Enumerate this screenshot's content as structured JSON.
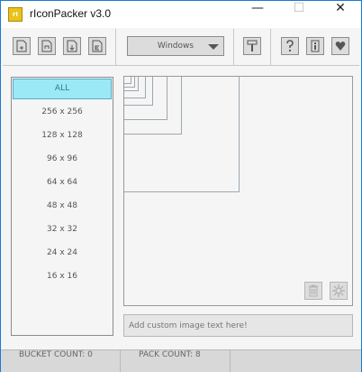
{
  "window": {
    "title": "rIconPacker v3.0",
    "icon_name": "app-logo-icon",
    "controls": {
      "minimize": "—",
      "maximize": "☐",
      "close": "✕"
    }
  },
  "toolbar": {
    "file_buttons": [
      "new-file-icon",
      "open-file-icon",
      "save-file-icon",
      "export-file-icon"
    ],
    "platform_dropdown": {
      "selected": "Windows"
    },
    "style_button": "paint-roller-icon",
    "help_buttons": [
      "help-icon",
      "info-icon",
      "heart-icon"
    ]
  },
  "sizes": {
    "items": [
      {
        "label": "ALL",
        "active": true
      },
      {
        "label": "256 x 256"
      },
      {
        "label": "128 x 128"
      },
      {
        "label": "96 x 96"
      },
      {
        "label": "64 x 64"
      },
      {
        "label": "48 x 48"
      },
      {
        "label": "32 x 32"
      },
      {
        "label": "24 x 24"
      },
      {
        "label": "16 x 16"
      }
    ]
  },
  "canvas": {
    "icon_sizes": [
      256,
      128,
      96,
      64,
      48,
      32,
      24,
      16
    ],
    "delete_icon": "trash-icon",
    "generate_icon": "gear-icon"
  },
  "custom_text": {
    "placeholder": "Add custom image text here!"
  },
  "status": {
    "bucket_count": "BUCKET COUNT: 0",
    "pack_count": "PACK COUNT: 8"
  },
  "colors": {
    "accent_selected": "#9be8f7",
    "window_border": "#1a7ad4"
  }
}
